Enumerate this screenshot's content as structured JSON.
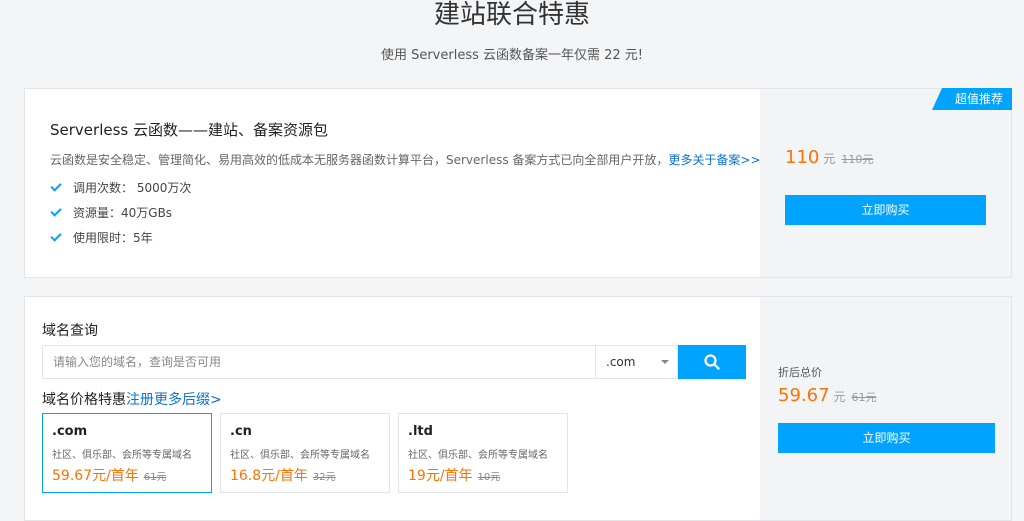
{
  "header": {
    "title": "建站联合特惠",
    "subtitle": "使用 Serverless 云函数备案一年仅需 22 元!"
  },
  "package": {
    "badge": "超值推荐",
    "title": "Serverless 云函数——建站、备案资源包",
    "desc": "云函数是安全稳定、管理简化、易用高效的低成本无服务器函数计算平台，Serverless 备案方式已向全部用户开放，",
    "more_link": "更多关于备案>>",
    "features": [
      "调用次数： 5000万次",
      "资源量：40万GBs",
      "使用限时：5年"
    ],
    "price": "110",
    "unit": "元",
    "old_price": "110元",
    "buy_label": "立即购买"
  },
  "domain": {
    "heading": "域名查询",
    "search_placeholder": "请输入您的域名，查询是否可用",
    "suffix": ".com",
    "promo_heading": "域名价格特惠",
    "promo_link": "注册更多后缀>",
    "cards": [
      {
        "ext": ".com",
        "desc": "社区、俱乐部、会所等专属域名",
        "price": "59.67元/首年",
        "old": "61元"
      },
      {
        "ext": ".cn",
        "desc": "社区、俱乐部、会所等专属域名",
        "price": "16.8元/首年",
        "old": "32元"
      },
      {
        "ext": ".ltd",
        "desc": "社区、俱乐部、会所等专属域名",
        "price": "19元/首年",
        "old": "10元"
      }
    ],
    "total_label": "折后总价",
    "total_price": "59.67",
    "total_unit": "元",
    "total_old": "61元",
    "buy_label": "立即购买"
  },
  "colors": {
    "accent": "#00a4ff",
    "price": "#ff7200",
    "link": "#0a72d9"
  }
}
